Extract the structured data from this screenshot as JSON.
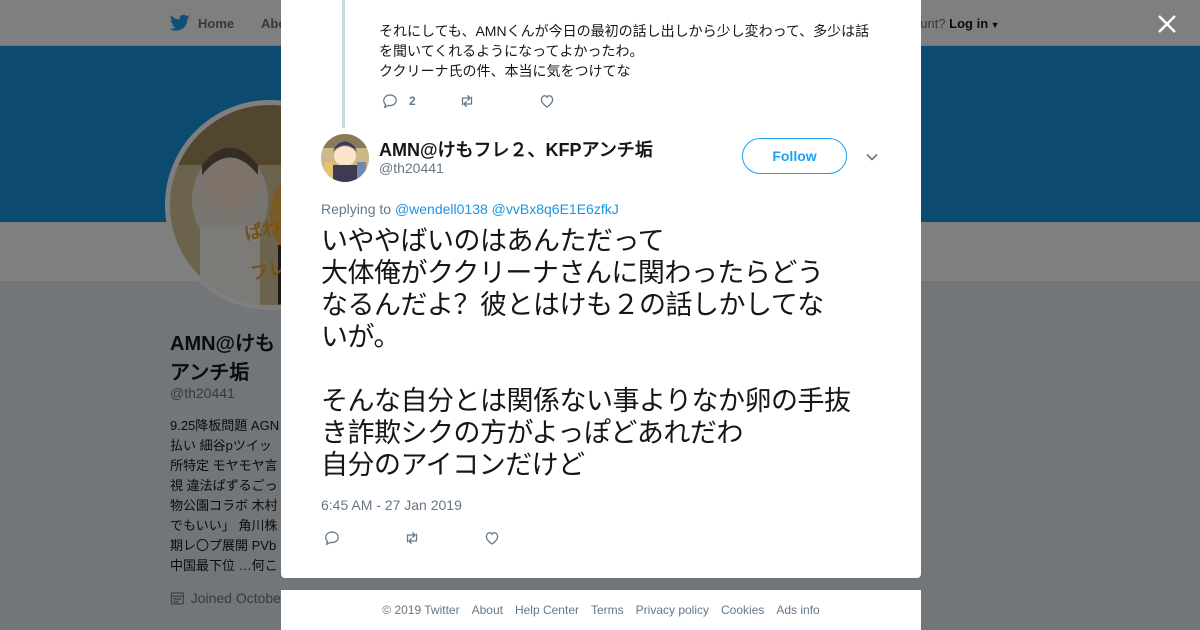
{
  "topbar": {
    "home_label": "Home",
    "about_label": "Abo",
    "account_prompt": "ccount?",
    "login_label": "Log in"
  },
  "profile": {
    "name_line1": "AMN@けも",
    "name_line2": "アンチ垢",
    "handle": "@th20441",
    "bio_lines": [
      "9.25降板問題 AGN",
      "払い 細谷pツイッ",
      "所特定 モヤモヤ言",
      "視 違法ぱずるごっ",
      "物公園コラボ 木村",
      "でもいい」 角川株",
      "期レ〇プ展開 PVb",
      "中国最下位 …何こ"
    ],
    "joined": "Joined Octobe"
  },
  "previous_tweet": {
    "text_lines": [
      "それにしても、AMNくんが今日の最初の話し出しから少し変わって、多少は話",
      "を聞いてくれるようになってよかったわ。",
      "ククリーナ氏の件、本当に気をつけてな"
    ],
    "reply_count": "2"
  },
  "tweet": {
    "author_name": "AMN@けもフレ２、KFPアンチ垢",
    "author_handle": "@th20441",
    "follow_label": "Follow",
    "replying_prefix": "Replying to",
    "reply_handle_1": "@wendell0138",
    "reply_handle_2": "@vvBx8q6E1E6zfkJ",
    "paragraph_1": "いややばいのはあんただって\n大体俺がククリーナさんに関わったらどう\nなるんだよ？彼とはけも２の話しかしてな\nいが。",
    "paragraph_2": "そんな自分とは関係ない事よりなか卵の手抜\nき詐欺シクの方がよっぽどあれだわ\n自分のアイコンだけど",
    "timestamp": "6:45 AM - 27 Jan 2019"
  },
  "footer": {
    "copyright": "© 2019 Twitter",
    "links": [
      "About",
      "Help Center",
      "Terms",
      "Privacy policy",
      "Cookies",
      "Ads info"
    ]
  },
  "colors": {
    "brand_blue": "#1da1f2",
    "banner_blue": "#1b95e0",
    "muted_gray": "#657786"
  }
}
